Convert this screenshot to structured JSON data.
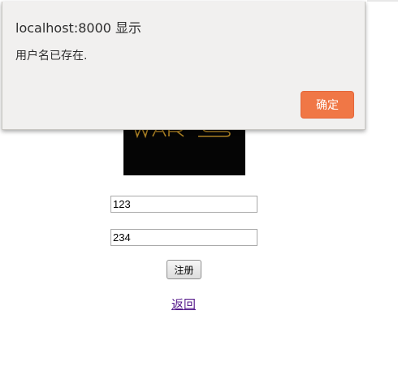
{
  "dialog": {
    "title": "localhost:8000 显示",
    "message": "用户名已存在.",
    "confirm_label": "确定",
    "accent_color": "#f07746"
  },
  "form": {
    "logo_icon": "star-wars-logo",
    "logo_text": "WARS",
    "username_value": "123",
    "password_value": "234",
    "register_label": "注册",
    "back_link_label": "返回"
  }
}
